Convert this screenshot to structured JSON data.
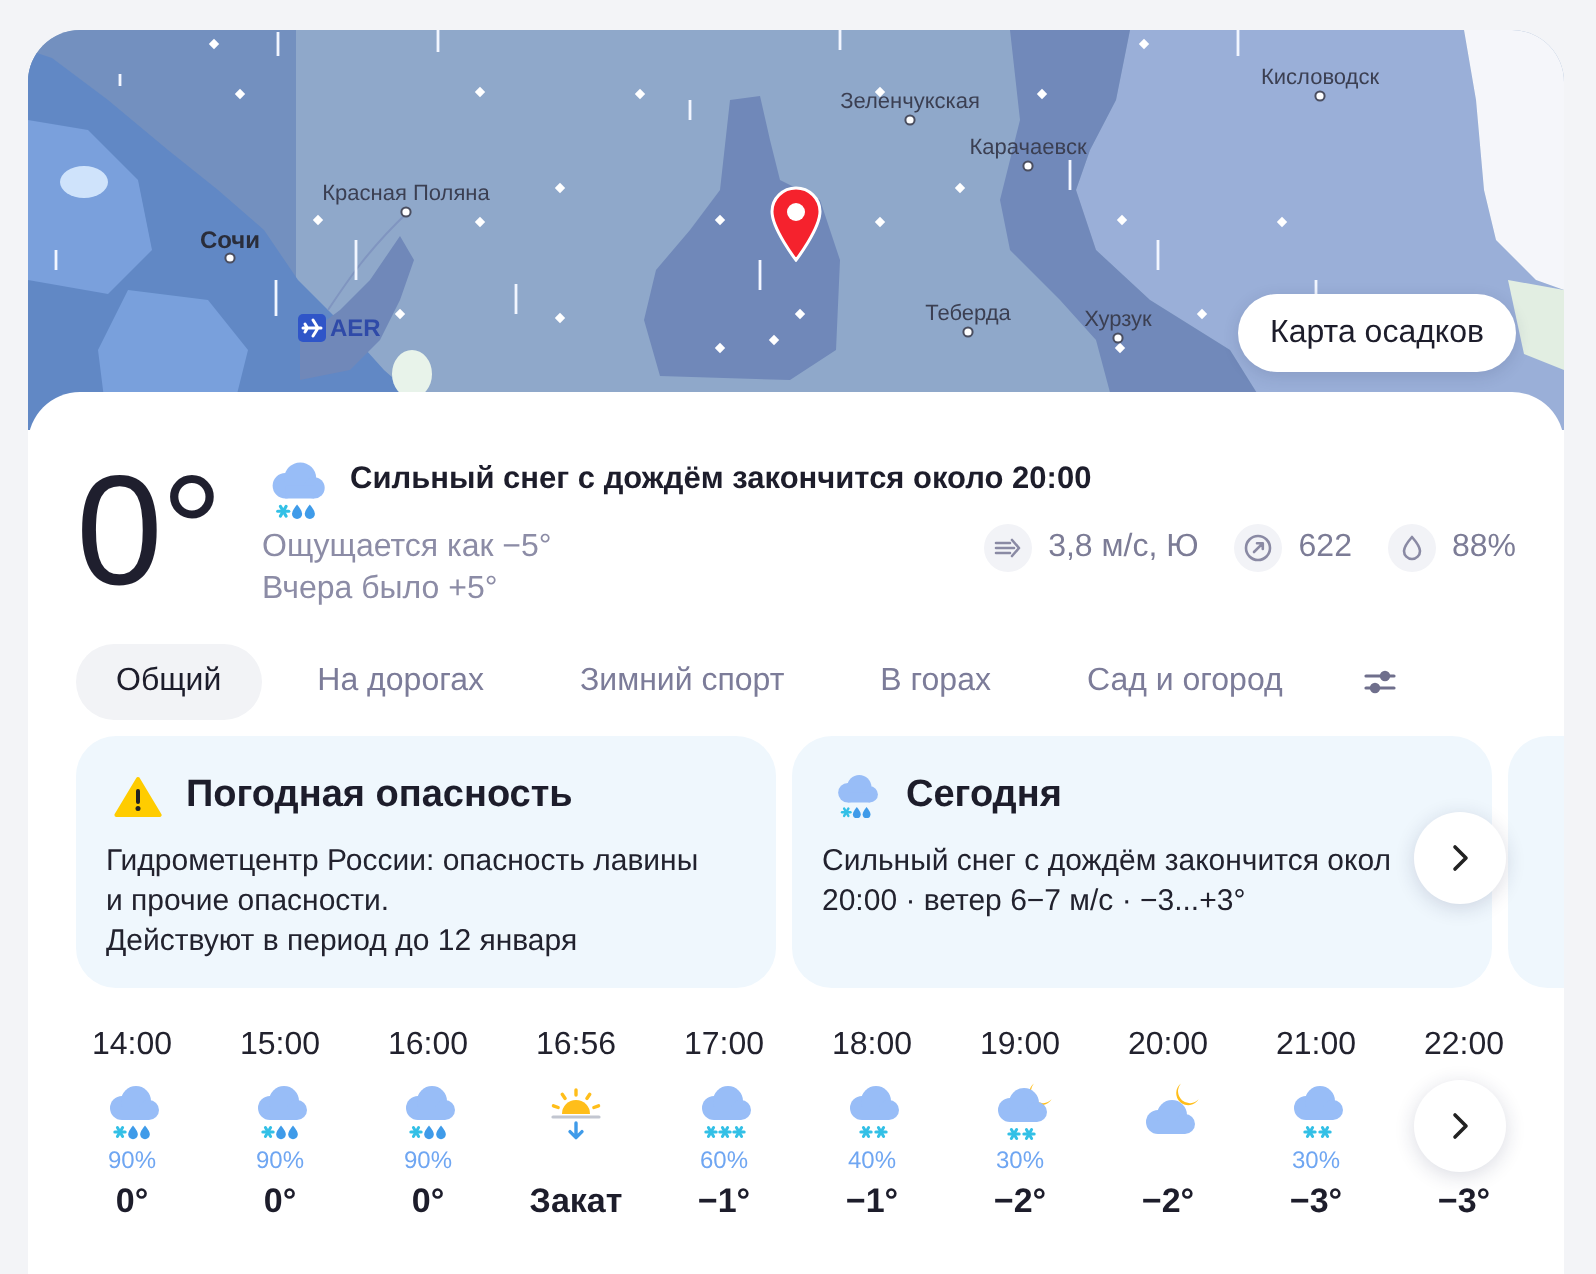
{
  "map": {
    "places": [
      {
        "name": "Кисловодск",
        "kind": "town"
      },
      {
        "name": "Зеленчукская",
        "kind": "town"
      },
      {
        "name": "Карачаевск",
        "kind": "town"
      },
      {
        "name": "Красная Поляна",
        "kind": "town"
      },
      {
        "name": "Сочи",
        "kind": "city"
      },
      {
        "name": "Теберда",
        "kind": "town"
      },
      {
        "name": "Хурзук",
        "kind": "town"
      }
    ],
    "airport": {
      "code": "AER"
    },
    "map_button": "Карта осадков"
  },
  "current": {
    "temp": "0°",
    "kind": "snow-rain",
    "condition": "Сильный снег с дождём закончится около 20:00",
    "feels_like": "Ощущается как −5°",
    "yesterday": "Вчера было +5°",
    "stats": [
      {
        "kind": "wind",
        "value": "3,8 м/с, Ю"
      },
      {
        "kind": "pressure",
        "value": "622"
      },
      {
        "kind": "humidity",
        "value": "88%"
      }
    ]
  },
  "tabs": [
    {
      "label": "Общий",
      "selected": true
    },
    {
      "label": "На дорогах",
      "selected": false
    },
    {
      "label": "Зимний спорт",
      "selected": false
    },
    {
      "label": "В горах",
      "selected": false
    },
    {
      "label": "Сад и огород",
      "selected": false
    }
  ],
  "cards": [
    {
      "kind": "warning",
      "title": "Погодная опасность",
      "lines": [
        "Гидрометцентр России: опасность лавины",
        "и прочие опасности.",
        "Действуют в период до 12 января"
      ]
    },
    {
      "kind": "snow-rain",
      "title": "Сегодня",
      "lines": [
        "Сильный снег с дождём закончится окол",
        "20:00 · ветер 6−7 м/с · −3...+3°"
      ]
    }
  ],
  "hourly": [
    {
      "kind": "snow-rain",
      "time": "14:00",
      "chance": "90%",
      "temp": "0°"
    },
    {
      "kind": "snow-rain",
      "time": "15:00",
      "chance": "90%",
      "temp": "0°"
    },
    {
      "kind": "snow-rain",
      "time": "16:00",
      "chance": "90%",
      "temp": "0°"
    },
    {
      "kind": "sunset",
      "time": "16:56",
      "label": "Закат"
    },
    {
      "kind": "heavy-snow",
      "time": "17:00",
      "chance": "60%",
      "temp": "−1°"
    },
    {
      "kind": "snow",
      "time": "18:00",
      "chance": "40%",
      "temp": "−1°"
    },
    {
      "kind": "night-snow",
      "time": "19:00",
      "chance": "30%",
      "temp": "−2°"
    },
    {
      "kind": "night-cloudy",
      "time": "20:00",
      "temp": "−2°"
    },
    {
      "kind": "snow",
      "time": "21:00",
      "chance": "30%",
      "temp": "−3°"
    },
    {
      "kind": "hour",
      "time": "22:00",
      "temp": "−3°"
    }
  ]
}
